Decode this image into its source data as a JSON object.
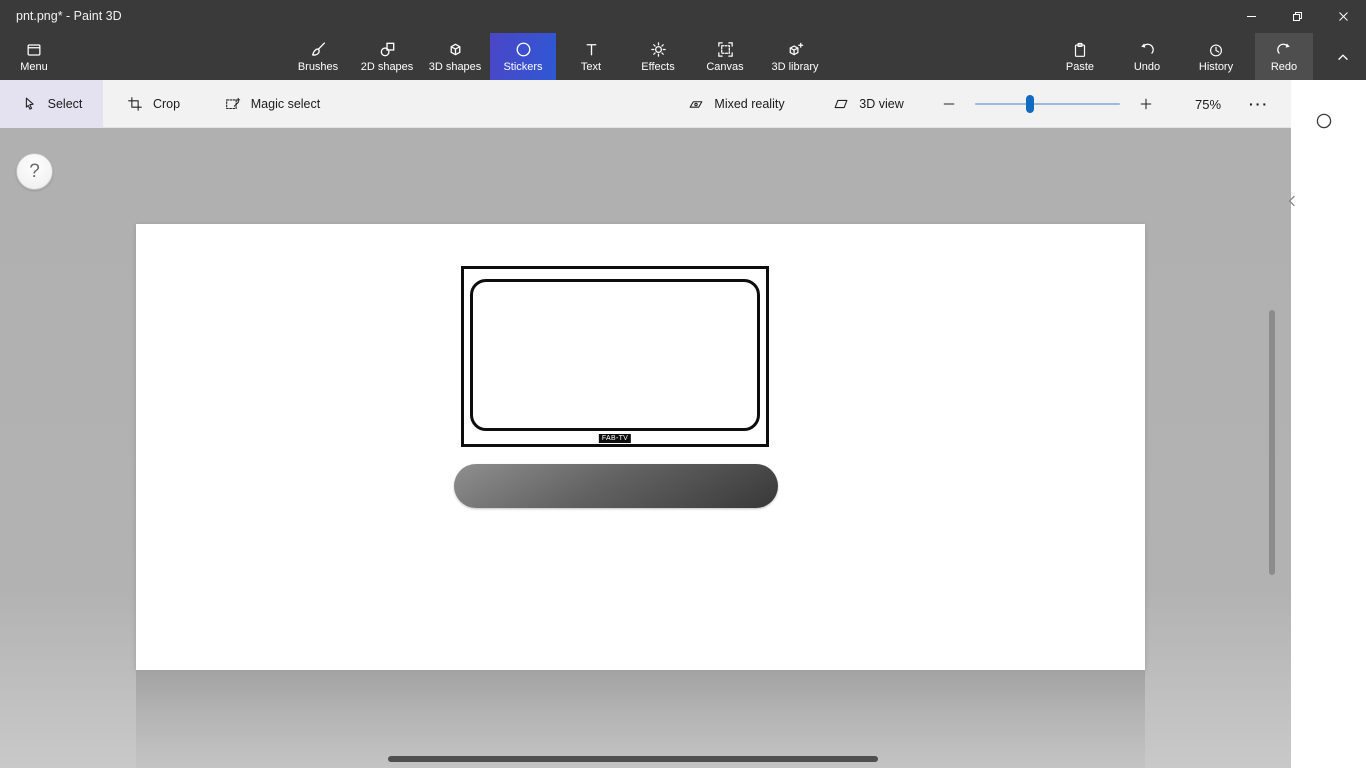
{
  "titlebar": {
    "title": "pnt.png* - Paint 3D"
  },
  "toolbar": {
    "menu": {
      "label": "Menu"
    },
    "tools": [
      {
        "label": "Brushes",
        "selected": false
      },
      {
        "label": "2D shapes",
        "selected": false
      },
      {
        "label": "3D shapes",
        "selected": false
      },
      {
        "label": "Stickers",
        "selected": true
      },
      {
        "label": "Text",
        "selected": false
      },
      {
        "label": "Effects",
        "selected": false
      },
      {
        "label": "Canvas",
        "selected": false
      },
      {
        "label": "3D library",
        "selected": false
      }
    ],
    "actions": [
      {
        "label": "Paste",
        "highlighted": false
      },
      {
        "label": "Undo",
        "highlighted": false
      },
      {
        "label": "History",
        "highlighted": false
      },
      {
        "label": "Redo",
        "highlighted": true
      }
    ]
  },
  "ribbon": {
    "select": {
      "label": "Select",
      "selected": true
    },
    "crop": {
      "label": "Crop"
    },
    "magic_select": {
      "label": "Magic select"
    },
    "mixed_reality": {
      "label": "Mixed reality"
    },
    "view_3d": {
      "label": "3D view"
    },
    "zoom": {
      "value": "75%",
      "more_glyph": "···"
    }
  },
  "canvas": {
    "help_glyph": "?",
    "tv_label": "FAB-TV"
  },
  "colors": {
    "chrome_bg": "#3a3a3a",
    "accent_selected_tab": "#3b51c9",
    "action_hover": "#4e4e4e",
    "ribbon_bg": "#f2f2f2",
    "select_highlight": "#e4e1f0",
    "slider_track": "#9db9dc",
    "slider_thumb": "#0f6cc0",
    "workspace_bg": "#b1b1b1"
  }
}
